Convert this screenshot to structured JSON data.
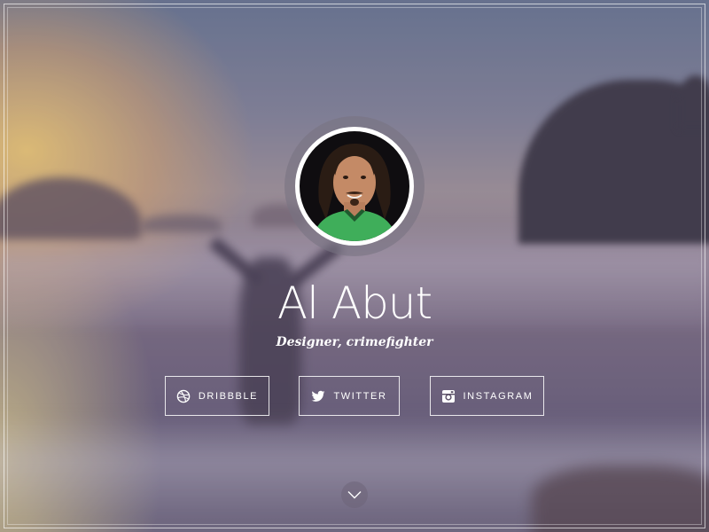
{
  "profile": {
    "name": "Al Abut",
    "tagline": "Designer, crimefighter"
  },
  "social": [
    {
      "label": "DRIBBBLE",
      "icon": "dribbble-icon"
    },
    {
      "label": "TWITTER",
      "icon": "twitter-icon"
    },
    {
      "label": "INSTAGRAM",
      "icon": "instagram-icon"
    }
  ],
  "scroll": {
    "icon": "chevron-down-icon"
  },
  "colors": {
    "text": "#ffffff",
    "button_border": "#ffffff"
  }
}
